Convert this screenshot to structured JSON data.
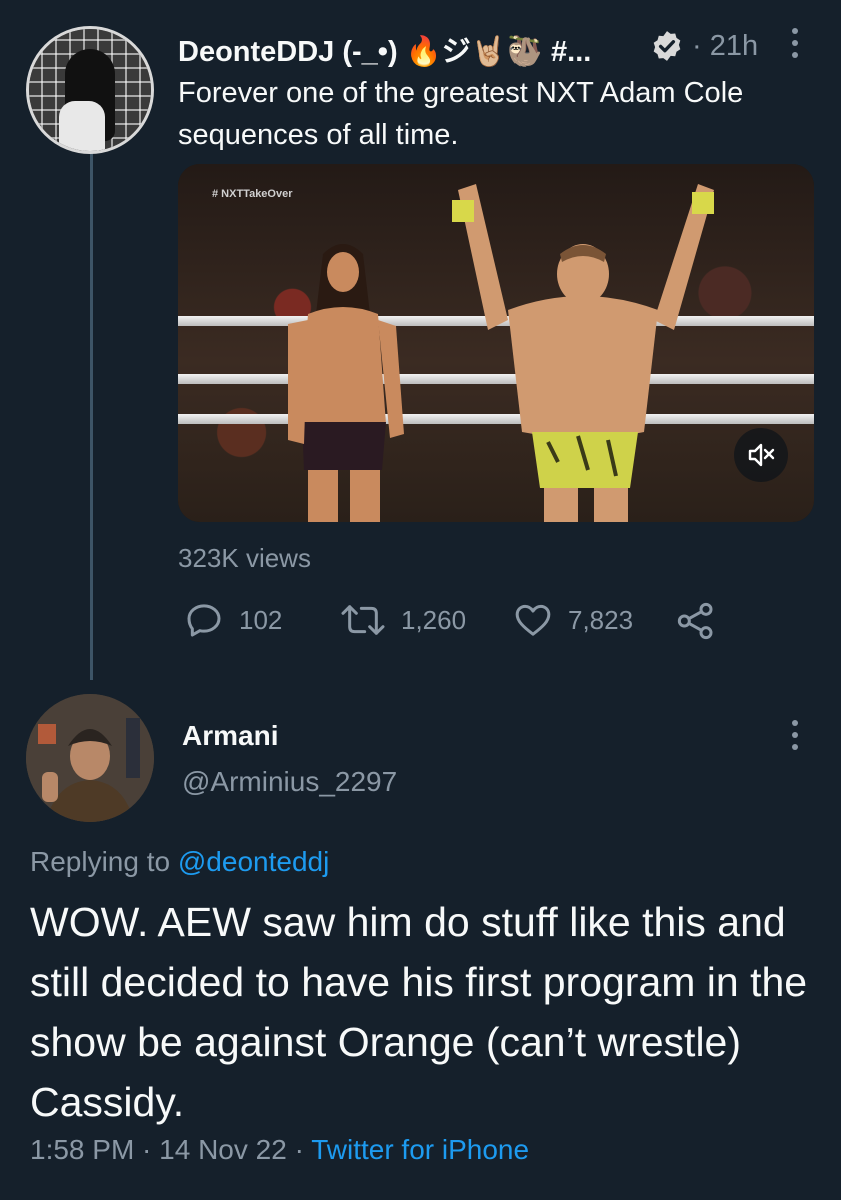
{
  "parent_tweet": {
    "display_name": "DeonteDDJ (-_•) 🔥ジ🤘🏼🦥 #...",
    "relative_time": "· 21h",
    "text": "Forever one of the greatest NXT Adam Cole sequences of all time.",
    "media": {
      "overlay_hashtag": "# NXTTakeOver"
    },
    "views": "323K views",
    "actions": {
      "replies": "102",
      "retweets": "1,260",
      "likes": "7,823"
    }
  },
  "reply_tweet": {
    "display_name": "Armani",
    "handle": "@Arminius_2297",
    "replying_to_prefix": "Replying to",
    "replying_to_mention": "@deonteddj",
    "text": "WOW. AEW saw him do stuff like this and still decided to have his first program in the show be against Orange (can’t wrestle) Cassidy.",
    "time": "1:58 PM · 14 Nov 22 ·",
    "source": "Twitter for iPhone"
  },
  "colors": {
    "background": "#15202b",
    "text_primary": "#f7f9f9",
    "text_secondary": "#8b98a5",
    "accent": "#1d9bf0",
    "thread_line": "#3d5466"
  },
  "icons": {
    "verified": "verified-badge-icon",
    "more": "more-vertical-icon",
    "reply": "reply-bubble-icon",
    "retweet": "retweet-icon",
    "like": "heart-icon",
    "share": "share-icon",
    "mute": "speaker-muted-icon"
  }
}
